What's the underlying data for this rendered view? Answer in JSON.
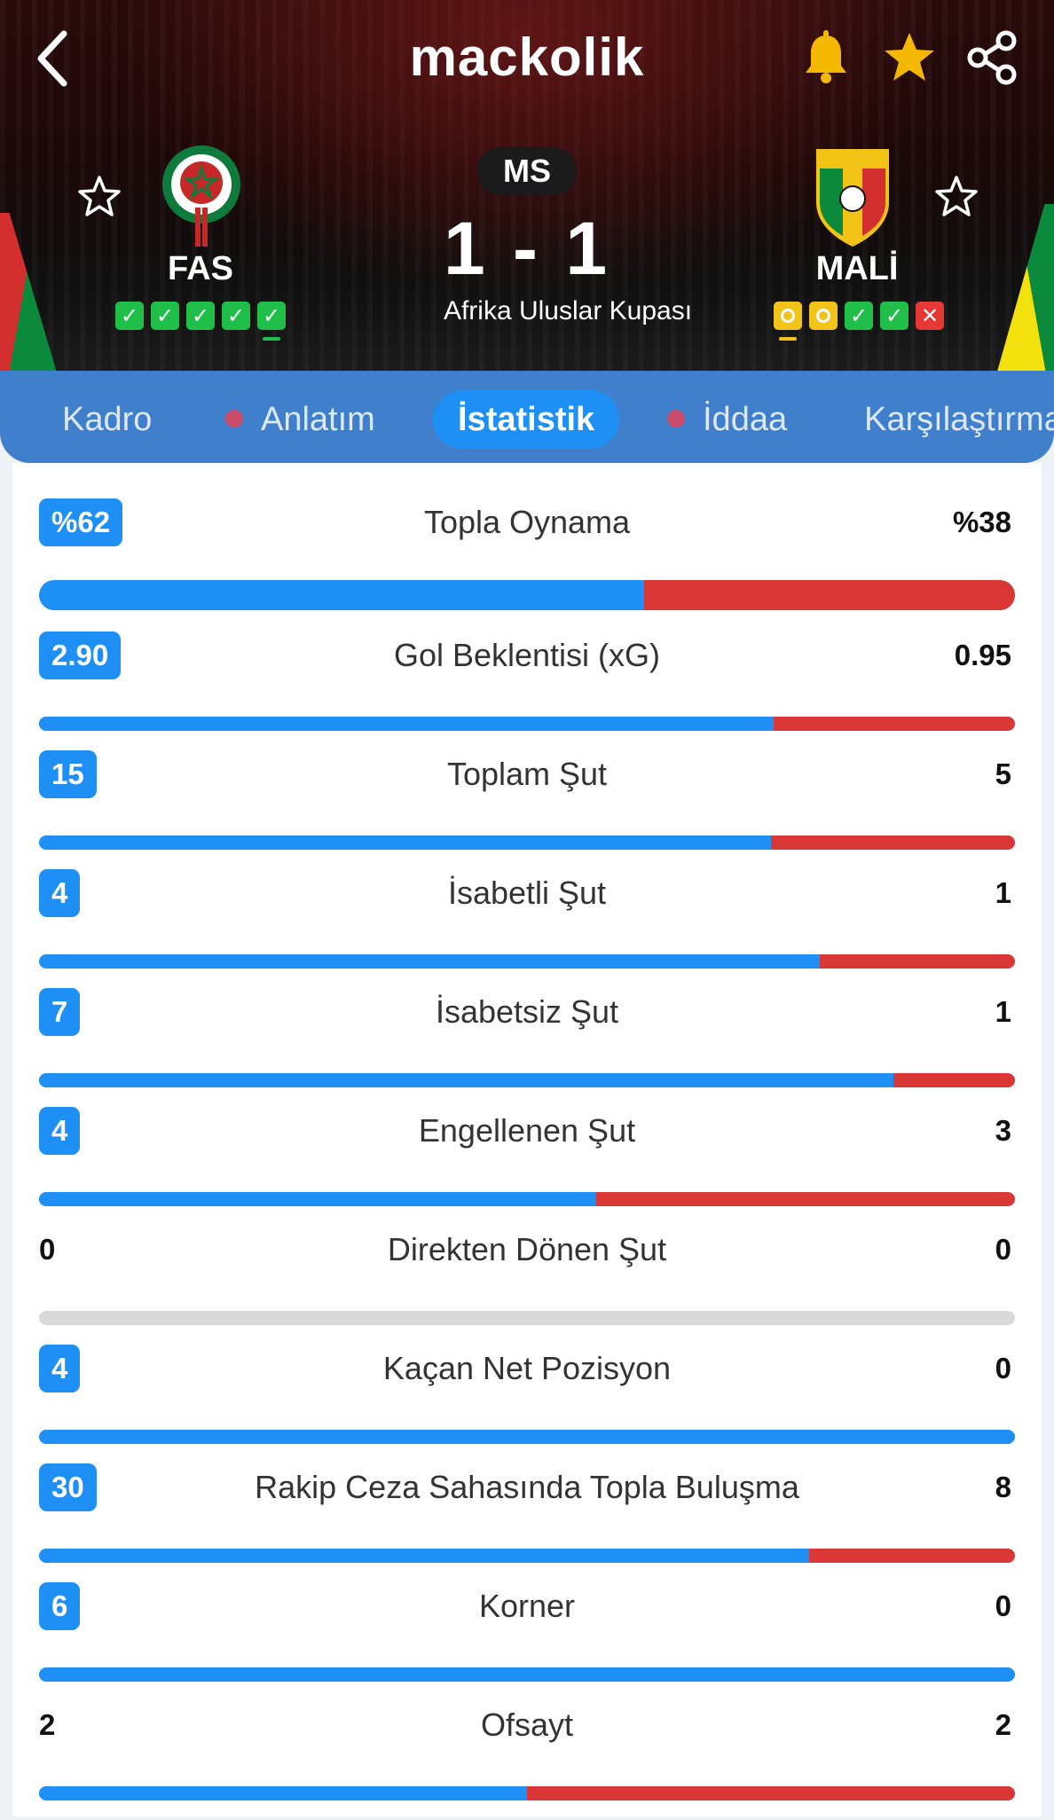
{
  "header": {
    "brand": "mackolik",
    "status": "MS",
    "score": "1 - 1",
    "competition": "Afrika Uluslar Kupası"
  },
  "home": {
    "name": "FAS",
    "form": [
      "W",
      "W",
      "W",
      "W",
      "W"
    ]
  },
  "away": {
    "name": "MALİ",
    "form": [
      "D",
      "D",
      "W",
      "W",
      "L"
    ]
  },
  "tabs": [
    {
      "label": "Kadro",
      "dot": false,
      "active": false
    },
    {
      "label": "Anlatım",
      "dot": true,
      "active": false
    },
    {
      "label": "İstatistik",
      "dot": false,
      "active": true
    },
    {
      "label": "İddaa",
      "dot": true,
      "active": false
    },
    {
      "label": "Karşılaştırma",
      "dot": false,
      "active": false
    }
  ],
  "stats": [
    {
      "label": "Topla Oynama",
      "home": "%62",
      "away": "%38",
      "home_share": 0.62,
      "home_badge": true
    },
    {
      "label": "Gol Beklentisi (xG)",
      "home": "2.90",
      "away": "0.95",
      "home_share": 0.753,
      "home_badge": true
    },
    {
      "label": "Toplam Şut",
      "home": "15",
      "away": "5",
      "home_share": 0.75,
      "home_badge": true
    },
    {
      "label": "İsabetli Şut",
      "home": "4",
      "away": "1",
      "home_share": 0.8,
      "home_badge": true
    },
    {
      "label": "İsabetsiz Şut",
      "home": "7",
      "away": "1",
      "home_share": 0.875,
      "home_badge": true
    },
    {
      "label": "Engellenen Şut",
      "home": "4",
      "away": "3",
      "home_share": 0.571,
      "home_badge": true
    },
    {
      "label": "Direkten Dönen Şut",
      "home": "0",
      "away": "0",
      "home_share": null,
      "home_badge": false
    },
    {
      "label": "Kaçan Net Pozisyon",
      "home": "4",
      "away": "0",
      "home_share": 1.0,
      "home_badge": true
    },
    {
      "label": "Rakip Ceza Sahasında Topla Buluşma",
      "home": "30",
      "away": "8",
      "home_share": 0.789,
      "home_badge": true
    },
    {
      "label": "Korner",
      "home": "6",
      "away": "0",
      "home_share": 1.0,
      "home_badge": true
    },
    {
      "label": "Ofsayt",
      "home": "2",
      "away": "2",
      "home_share": 0.5,
      "home_badge": false
    }
  ],
  "colors": {
    "home_bar": "#1e8ff4",
    "away_bar": "#d93636",
    "tab_bar": "#3f7fcb",
    "empty_bar": "#d9d9d9"
  },
  "icons": [
    "back-icon",
    "bell-icon",
    "star-icon",
    "share-icon",
    "star-outline-icon"
  ]
}
